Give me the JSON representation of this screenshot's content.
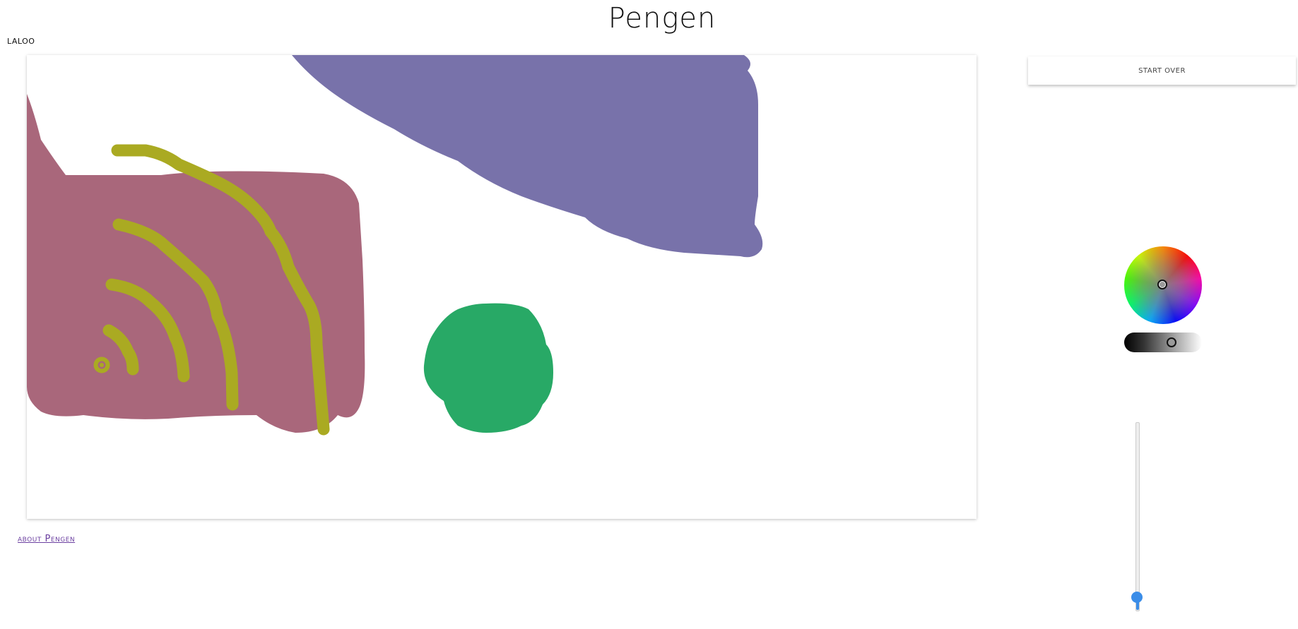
{
  "header": {
    "title": "Pengen"
  },
  "user": {
    "name": "LALOO"
  },
  "canvas": {
    "strokes": [
      {
        "name": "purple-blob",
        "color": "#7872aa"
      },
      {
        "name": "mauve-blob",
        "color": "#a9677b"
      },
      {
        "name": "olive-arcs",
        "color": "#aaaa22"
      },
      {
        "name": "green-circle",
        "color": "#28a966"
      }
    ]
  },
  "footer": {
    "about_label": "about Pengen"
  },
  "controls": {
    "start_over_label": "START OVER",
    "brush_size_fraction": 0.05
  }
}
